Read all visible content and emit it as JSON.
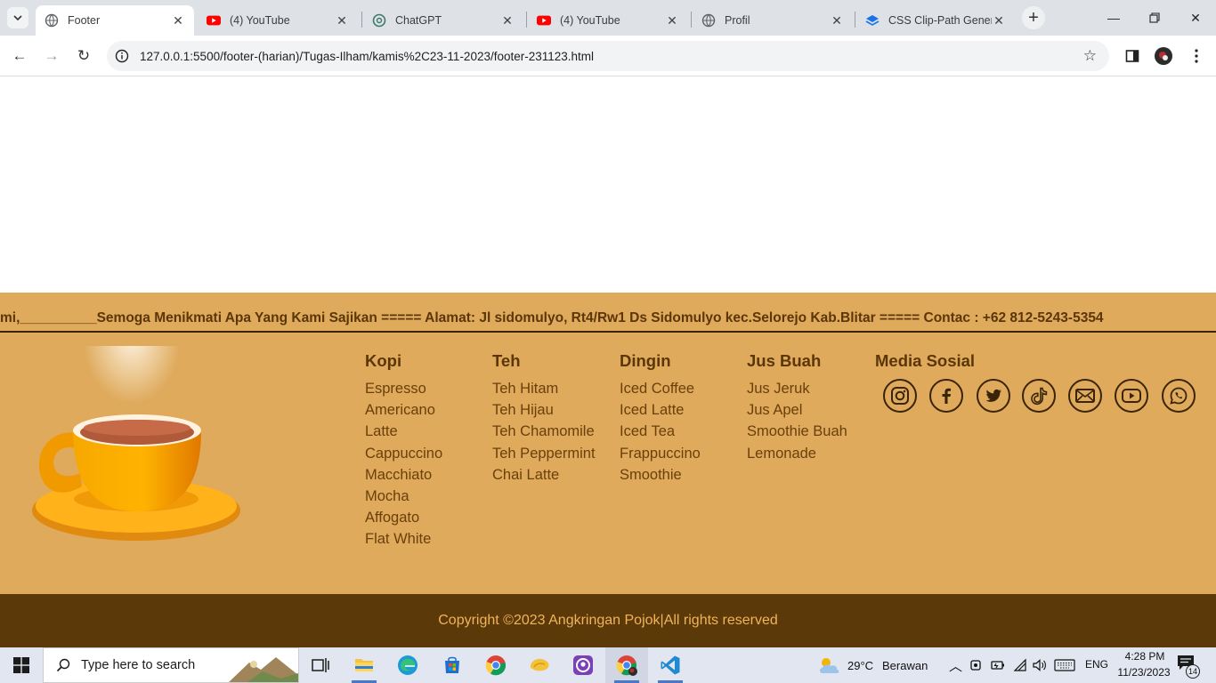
{
  "browser": {
    "tabs": [
      {
        "title": "Footer",
        "icon": "globe-icon",
        "active": true
      },
      {
        "title": "(4) YouTube",
        "icon": "youtube-icon",
        "active": false
      },
      {
        "title": "ChatGPT",
        "icon": "chatgpt-icon",
        "active": false
      },
      {
        "title": "(4) YouTube",
        "icon": "youtube-icon",
        "active": false
      },
      {
        "title": "Profil",
        "icon": "globe-icon",
        "active": false
      },
      {
        "title": "CSS Clip-Path Genera",
        "icon": "layers-icon",
        "active": false
      }
    ],
    "url": "127.0.0.1:5500/footer-(harian)/Tugas-Ilham/kamis%2C23-11-2023/footer-231123.html"
  },
  "footer": {
    "marquee": "mi,__________Semoga Menikmati Apa Yang Kami Sajikan ===== Alamat: Jl sidomulyo, Rt4/Rw1 Ds Sidomulyo kec.Selorejo Kab.Blitar ===== Contac : +62 812-5243-5354",
    "columns": [
      {
        "title": "Kopi",
        "items": [
          "Espresso",
          "Americano",
          "Latte",
          "Cappuccino",
          "Macchiato",
          "Mocha",
          "Affogato",
          "Flat White"
        ]
      },
      {
        "title": "Teh",
        "items": [
          "Teh Hitam",
          "Teh Hijau",
          "Teh Chamomile",
          "Teh Peppermint",
          "Chai Latte"
        ]
      },
      {
        "title": "Dingin",
        "items": [
          "Iced Coffee",
          "Iced Latte",
          "Iced Tea",
          "Frappuccino",
          "Smoothie"
        ]
      },
      {
        "title": "Jus Buah",
        "items": [
          "Jus Jeruk",
          "Jus Apel",
          "Smoothie Buah",
          "Lemonade"
        ]
      }
    ],
    "social_title": "Media Sosial",
    "social_icons": [
      "instagram-icon",
      "facebook-icon",
      "twitter-icon",
      "tiktok-icon",
      "mail-icon",
      "youtube-icon",
      "whatsapp-icon"
    ],
    "copyright": "Copyright ©2023 Angkringan Pojok|All rights reserved",
    "colors": {
      "footer_bg": "#dfaa5c",
      "copyright_bg": "#5b3909",
      "copyright_text": "#f0b45a",
      "text": "#6b3f0a"
    }
  },
  "taskbar": {
    "search_placeholder": "Type here to search",
    "weather_temp": "29°C",
    "weather_desc": "Berawan",
    "language": "ENG",
    "time": "4:28 PM",
    "date": "11/23/2023",
    "notification_count": "14"
  }
}
